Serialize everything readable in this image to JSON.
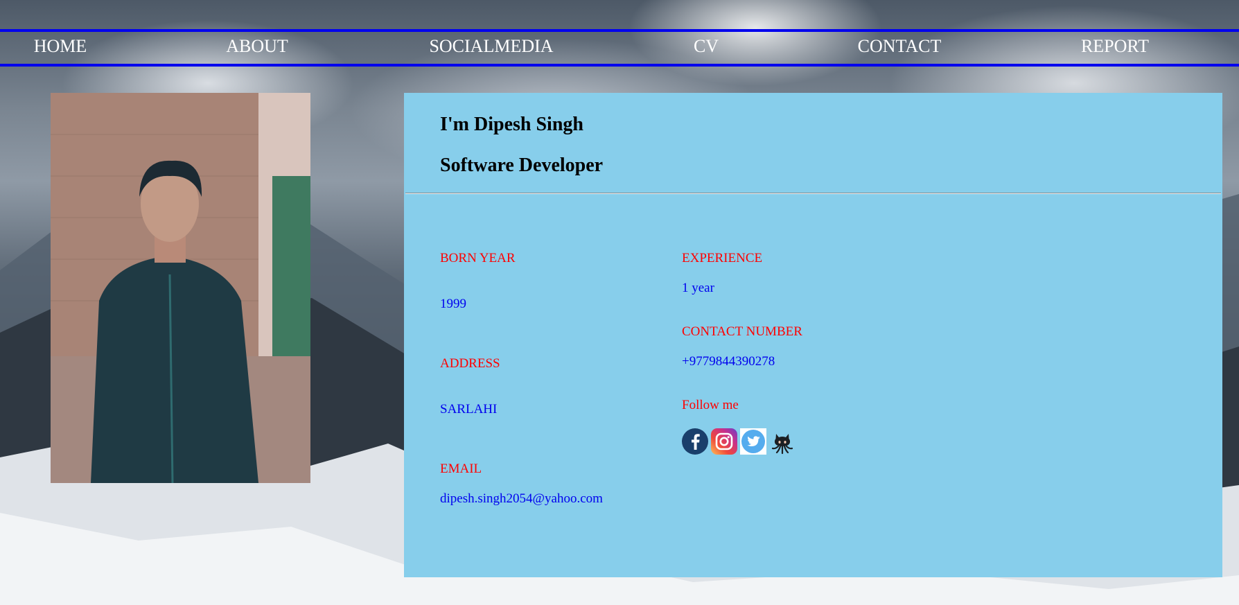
{
  "nav": {
    "items": [
      {
        "label": "HOME"
      },
      {
        "label": "ABOUT"
      },
      {
        "label": "SOCIALMEDIA"
      },
      {
        "label": "CV"
      },
      {
        "label": "CONTACT"
      },
      {
        "label": "REPORT"
      }
    ]
  },
  "profile": {
    "intro": "I'm Dipesh Singh",
    "role": "Software Developer"
  },
  "details": {
    "born_year": {
      "label": "BORN YEAR",
      "value": "1999"
    },
    "address": {
      "label": "ADDRESS",
      "value": "SARLAHI"
    },
    "email": {
      "label": "EMAIL",
      "value": "dipesh.singh2054@yahoo.com"
    },
    "experience": {
      "label": "EXPERIENCE",
      "value": "1 year"
    },
    "contact_number": {
      "label": "CONTACT NUMBER",
      "value": "+9779844390278"
    },
    "follow": {
      "label": "Follow me"
    }
  },
  "social_icons": [
    "facebook-icon",
    "instagram-icon",
    "twitter-icon",
    "github-icon"
  ],
  "colors": {
    "nav_border": "#0000ee",
    "card_bg": "#87ceeb",
    "label": "#ff0000",
    "value": "#0000ee"
  }
}
